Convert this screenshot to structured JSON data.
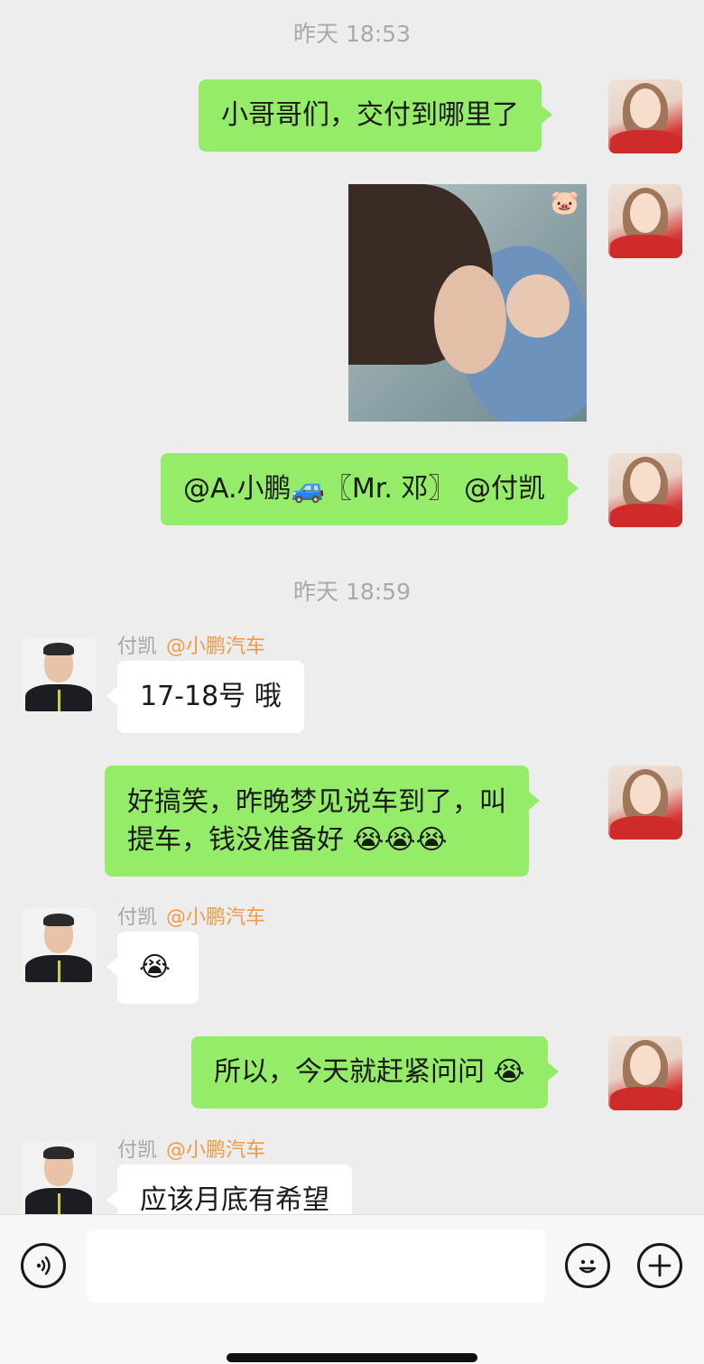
{
  "timestamps": [
    "昨天 18:53",
    "昨天 18:59"
  ],
  "messages": {
    "m1": "小哥哥们，交付到哪里了",
    "m3": "@A.小鹏🚙〖Mr. 邓〗 @付凯",
    "m4_sender": "付凯",
    "m4_group": "@小鹏汽车",
    "m4": "17-18号 哦",
    "m5_line1": "好搞笑，昨晚梦见说车到了，叫",
    "m5_line2": "提车，钱没准备好 😭😭😭",
    "m6_sender": "付凯",
    "m6_group": "@小鹏汽车",
    "m6": "😭",
    "m7": "所以，今天就赶紧问问 😭",
    "m8_sender": "付凯",
    "m8_group": "@小鹏汽车",
    "m8": "应该月底有希望"
  },
  "photo": {
    "sticker": "🐷"
  },
  "input_bar": {
    "voice_icon": "voice-icon",
    "emoji_icon": "emoji-icon",
    "plus_icon": "plus-icon"
  }
}
